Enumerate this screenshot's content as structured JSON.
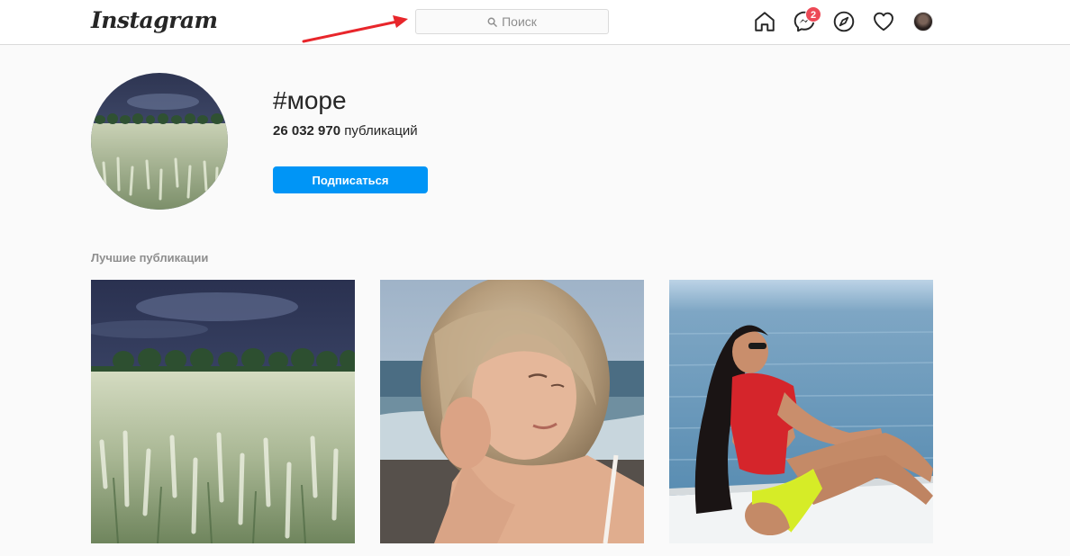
{
  "header": {
    "logo_text": "Instagram",
    "search": {
      "placeholder": "Поиск"
    },
    "messages_badge": "2",
    "nav_icons": [
      "home-icon",
      "messenger-icon",
      "explore-icon",
      "heart-icon",
      "profile-avatar"
    ]
  },
  "hashtag": {
    "title": "#море",
    "post_count": "26 032 970",
    "post_count_label": "публикаций",
    "follow_label": "Подписаться"
  },
  "top_posts": {
    "section_title": "Лучшие публикации",
    "posts": [
      {
        "subject": "wheat-field-storm"
      },
      {
        "subject": "woman-by-sea"
      },
      {
        "subject": "woman-on-boat"
      }
    ]
  },
  "colors": {
    "accent": "#0095f6",
    "badge": "#ed4956",
    "annotation_arrow": "#e8262b"
  }
}
